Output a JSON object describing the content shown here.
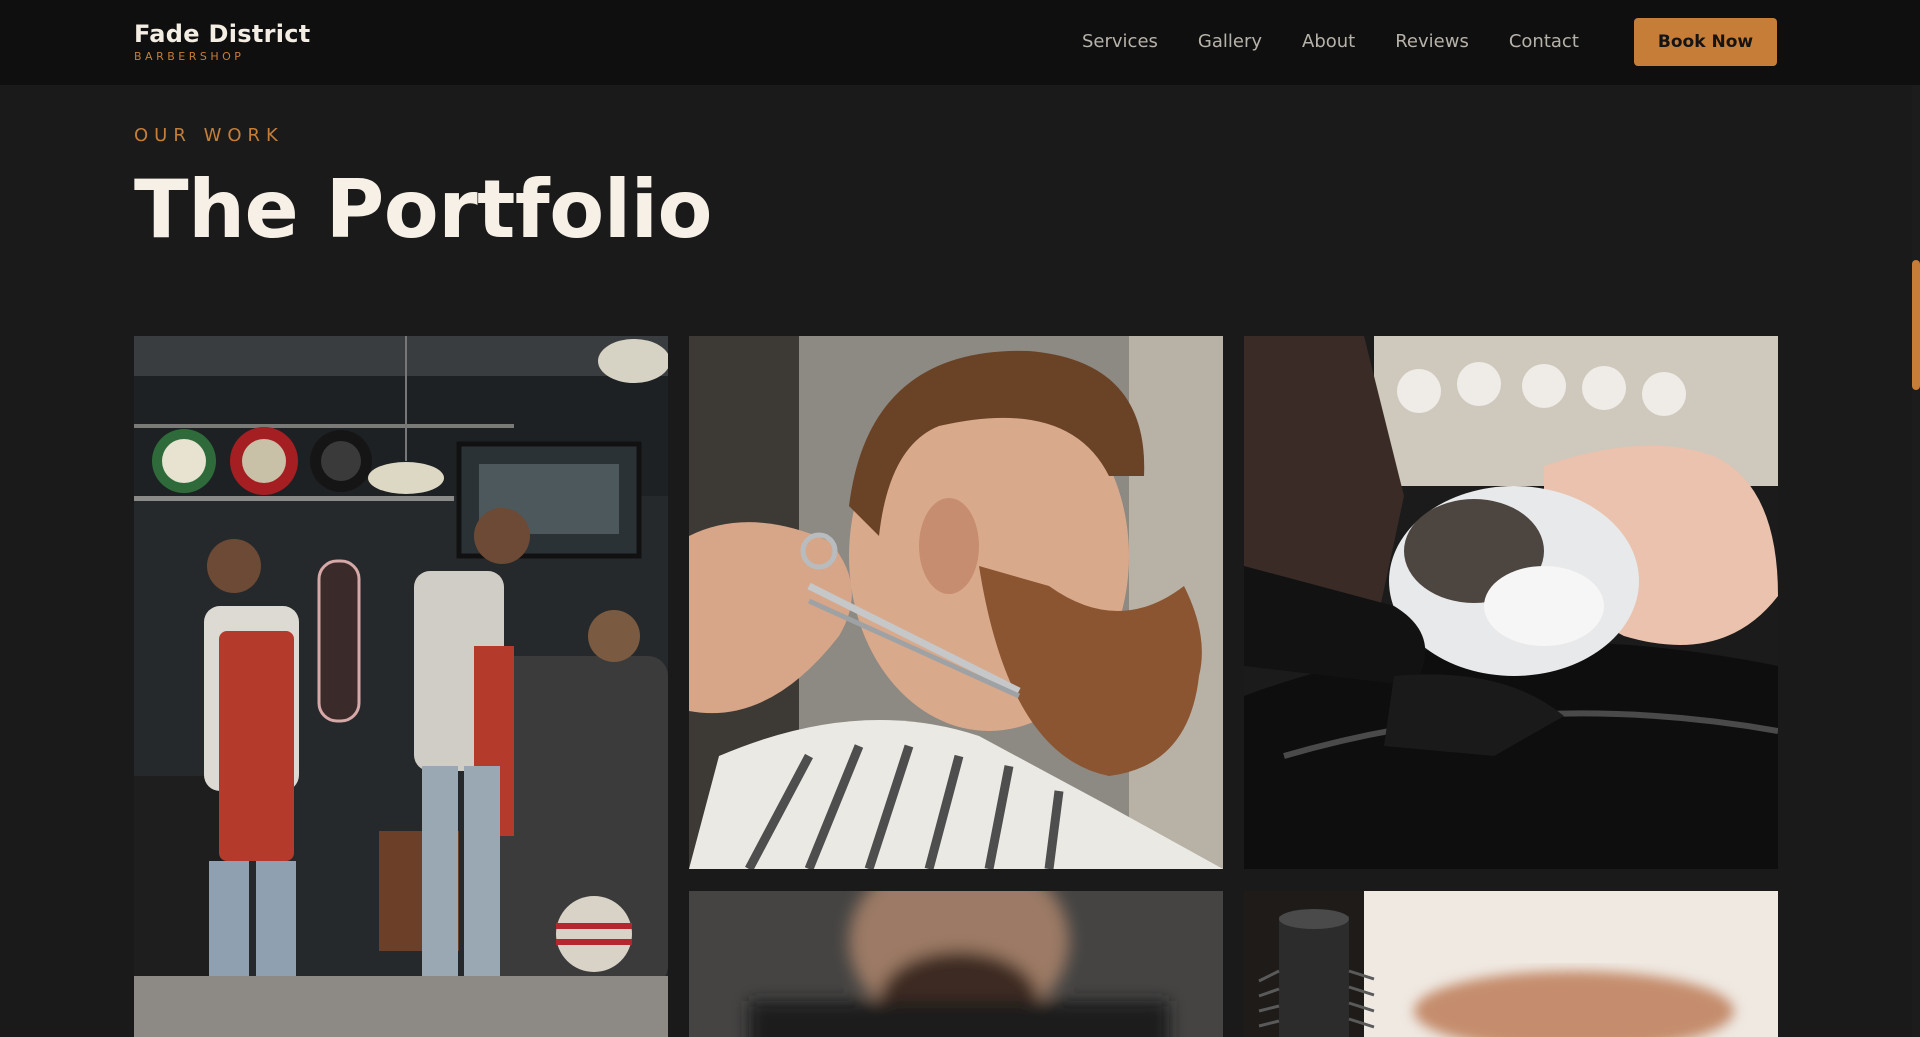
{
  "header": {
    "brand_name": "Fade District",
    "brand_tagline": "BARBERSHOP",
    "nav": [
      {
        "label": "Services"
      },
      {
        "label": "Gallery"
      },
      {
        "label": "About"
      },
      {
        "label": "Reviews"
      },
      {
        "label": "Contact"
      }
    ],
    "cta_label": "Book Now"
  },
  "hero": {
    "eyebrow": "OUR WORK",
    "title": "The Portfolio"
  },
  "gallery": {
    "photos": [
      {
        "subject": "barbershop-interior"
      },
      {
        "subject": "beard-trim"
      },
      {
        "subject": "hair-wash"
      },
      {
        "subject": "blurred-portrait"
      },
      {
        "subject": "round-brush"
      }
    ]
  },
  "colors": {
    "background": "#1a1a1a",
    "header": "#0f0f0f",
    "accent": "#c67d37",
    "text": "#f3ede3",
    "nav_text": "#b7b2a9"
  },
  "icons": [
    "vertical-scrollbar"
  ]
}
